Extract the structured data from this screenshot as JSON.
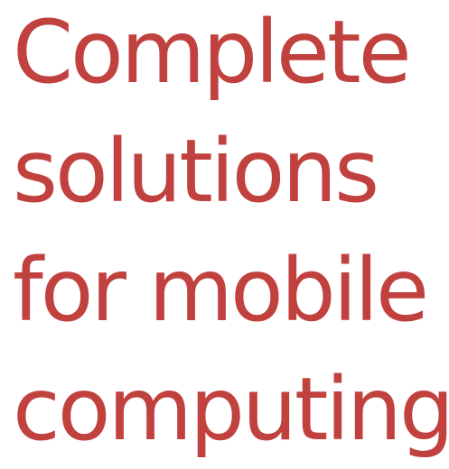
{
  "headline": {
    "lines": [
      "Complete",
      "solutions",
      "for mobile",
      "computing"
    ],
    "color": "#c0413e"
  }
}
